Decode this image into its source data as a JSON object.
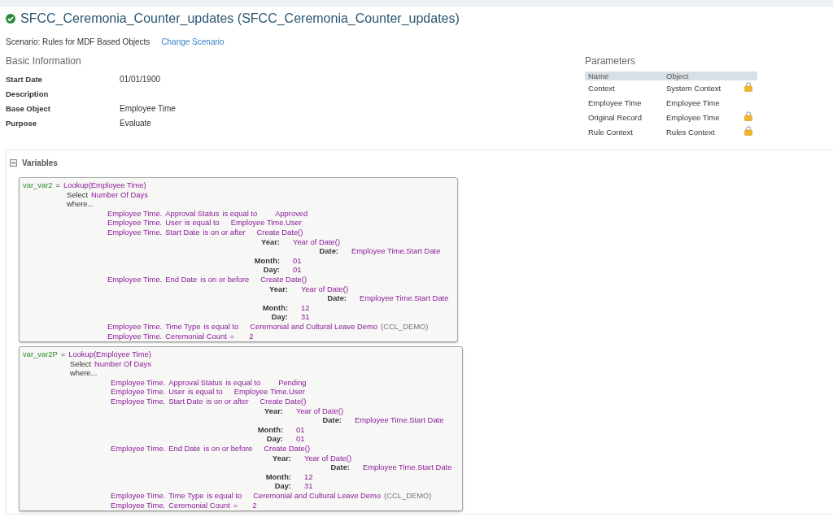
{
  "header": {
    "title": "SFCC_Ceremonia_Counter_updates (SFCC_Ceremonia_Counter_updates)",
    "scenario": "Scenario: Rules for MDF Based Objects",
    "change_link": "Change Scenario"
  },
  "basic_information": {
    "heading": "Basic Information",
    "fields": [
      {
        "label": "Start Date",
        "value": "01/01/1900"
      },
      {
        "label": "Description"
      },
      {
        "label": "Base Object",
        "value": "Employee Time"
      },
      {
        "label": "Purpose",
        "value": "Evaluate"
      }
    ]
  },
  "parameters": {
    "heading": "Parameters",
    "columns": [
      "Name",
      "Object"
    ],
    "rows": [
      {
        "name": "Context",
        "object": "System Context",
        "locked": true
      },
      {
        "name": "Employee Time",
        "object": "Employee Time",
        "locked": false
      },
      {
        "name": "Original Record",
        "object": "Employee Time",
        "locked": true
      },
      {
        "name": "Rule Context",
        "object": "Rules Context",
        "locked": true
      }
    ]
  },
  "variables": {
    "heading": "Variables",
    "expanded": true,
    "items": [
      {
        "name": "var_var2",
        "equals": "=",
        "lookup": "Lookup(Employee Time)",
        "select": "Select",
        "select_field": "Number Of Days",
        "where": "where...",
        "conditions": [
          {
            "kind": "simple",
            "object": "Employee Time.",
            "field": "Approval Status",
            "operator": "is equal to",
            "value": "Approved"
          },
          {
            "kind": "simple",
            "object": "Employee Time.",
            "field": "User",
            "operator": "is equal to",
            "value": "Employee Time.User"
          },
          {
            "kind": "date",
            "object": "Employee Time.",
            "field": "Start Date",
            "operator": "is on or after",
            "value": "Create Date()",
            "year_label": "Year:",
            "year_value": "Year of Date()",
            "date_label": "Date:",
            "date_value": "Employee Time.Start Date",
            "month_label": "Month:",
            "month_value": "01",
            "day_label": "Day:",
            "day_value": "01"
          },
          {
            "kind": "date",
            "object": "Employee Time.",
            "field": "End Date",
            "operator": "is on or before",
            "value": "Create Date()",
            "year_label": "Year:",
            "year_value": "Year of Date()",
            "date_label": "Date:",
            "date_value": "Employee Time.Start Date",
            "month_label": "Month:",
            "month_value": "12",
            "day_label": "Day:",
            "day_value": "31"
          },
          {
            "kind": "simple",
            "object": "Employee Time.",
            "field": "Time Type",
            "operator": "is equal to",
            "value": "Ceremonial and Cultural Leave Demo",
            "code": "(CCL_DEMO)"
          },
          {
            "kind": "simple",
            "object": "Employee Time.",
            "field": "Ceremonial Count",
            "operator": "=",
            "value": "2"
          }
        ]
      },
      {
        "name": "var_var2P",
        "equals": "=",
        "lookup": "Lookup(Employee Time)",
        "select": "Select",
        "select_field": "Number Of Days",
        "where": "where...",
        "conditions": [
          {
            "kind": "simple",
            "object": "Employee Time.",
            "field": "Approval Status",
            "operator": "is equal to",
            "value": "Pending"
          },
          {
            "kind": "simple",
            "object": "Employee Time.",
            "field": "User",
            "operator": "is equal to",
            "value": "Employee Time.User"
          },
          {
            "kind": "date",
            "object": "Employee Time.",
            "field": "Start Date",
            "operator": "is on or after",
            "value": "Create Date()",
            "year_label": "Year:",
            "year_value": "Year of Date()",
            "date_label": "Date:",
            "date_value": "Employee Time.Start Date",
            "month_label": "Month:",
            "month_value": "01",
            "day_label": "Day:",
            "day_value": "01"
          },
          {
            "kind": "date",
            "object": "Employee Time.",
            "field": "End Date",
            "operator": "is on or before",
            "value": "Create Date()",
            "year_label": "Year:",
            "year_value": "Year of Date()",
            "date_label": "Date:",
            "date_value": "Employee Time.Start Date",
            "month_label": "Month:",
            "month_value": "12",
            "day_label": "Day:",
            "day_value": "31"
          },
          {
            "kind": "simple",
            "object": "Employee Time.",
            "field": "Time Type",
            "operator": "is equal to",
            "value": "Ceremonial and Cultural Leave Demo",
            "code": "(CCL_DEMO)"
          },
          {
            "kind": "simple",
            "object": "Employee Time.",
            "field": "Ceremonial Count",
            "operator": "=",
            "value": "2"
          }
        ]
      }
    ]
  }
}
